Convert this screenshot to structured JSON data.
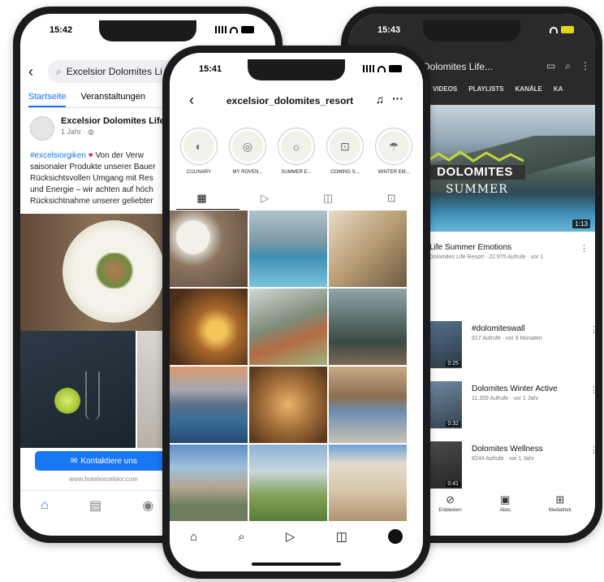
{
  "facebook": {
    "time": "15:42",
    "search_text": "Excelsior Dolomites Li",
    "tabs": [
      "Startseite",
      "Veranstaltungen"
    ],
    "post_name": "Excelsior Dolomites Life",
    "post_meta": "1 Jahr",
    "post_text": {
      "hashtag": "#excelsiorgiken",
      "line1": "Von der Verw",
      "line2": "saisonaler Produkte unserer Bauer",
      "line3": "Rücksichtsvollen Umgang mit Res",
      "line4": "und Energie – wir achten auf höch",
      "line5": "Rücksichtnahme unserer geliebter"
    },
    "contact_button": "Kontaktiere uns",
    "url": "www.hotelexcelsior.com"
  },
  "instagram": {
    "time": "15:41",
    "username": "excelsior_dolomites_resort",
    "highlights": [
      "CULINARY",
      "MY ROVEN...",
      "SUMMER E...",
      "COMING S...",
      "WINTER EM..."
    ]
  },
  "youtube": {
    "time": "15:43",
    "title": "Dolomites Life...",
    "tabs": [
      "VIDEOS",
      "PLAYLISTS",
      "KANÄLE",
      "KA"
    ],
    "banner_logo": "DOLOMITES",
    "banner_sub": "SUMMER",
    "main_duration": "1:13",
    "main_title": "Life Summer Emotions",
    "main_meta": "Dolomites Life Resort · 22.975 Aufrufe · vor 1",
    "videos": [
      {
        "title": "#dolomiteswall",
        "meta": "917 Aufrufe · vor 9 Monaten",
        "duration": "0:25"
      },
      {
        "title": "Dolomites Winter Active",
        "meta": "11.359 Aufrufe · vor 1 Jahr",
        "duration": "0:32"
      },
      {
        "title": "Dolomites Wellness",
        "meta": "8244 Aufrufe · vor 1 Jahr",
        "duration": "0:41"
      }
    ],
    "nav": [
      "Entdecken",
      "Abos",
      "Mediathek"
    ]
  }
}
